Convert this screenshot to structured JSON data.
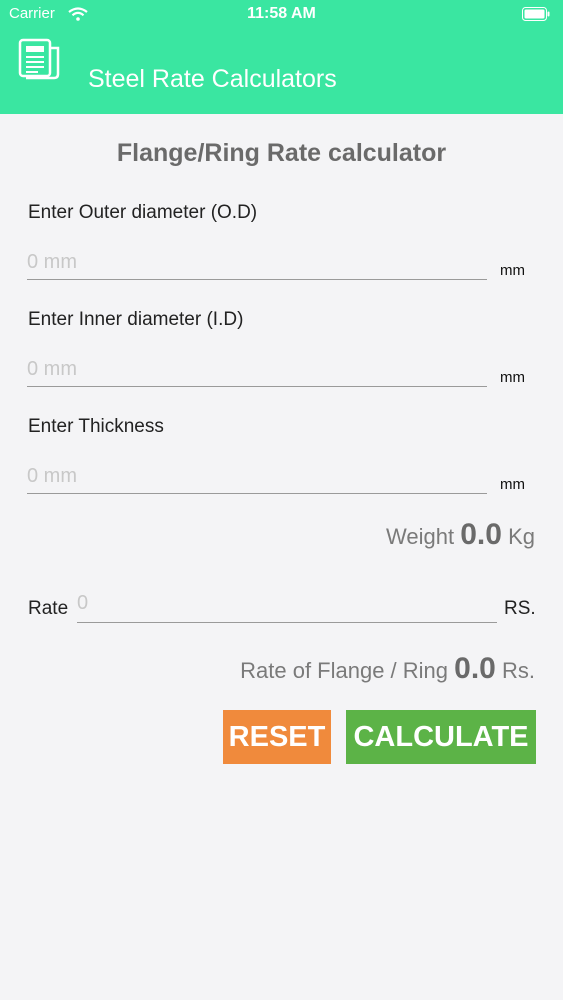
{
  "status_bar": {
    "carrier": "Carrier",
    "time": "11:58 AM"
  },
  "header": {
    "title": "Steel Rate Calculators",
    "icon": "document-icon"
  },
  "page": {
    "title": "Flange/Ring Rate calculator"
  },
  "fields": [
    {
      "label": "Enter Outer diameter (O.D)",
      "placeholder": "0 mm",
      "unit": "mm"
    },
    {
      "label": "Enter Inner diameter (I.D)",
      "placeholder": "0 mm",
      "unit": "mm"
    },
    {
      "label": "Enter Thickness",
      "placeholder": "0 mm",
      "unit": "mm"
    }
  ],
  "weight": {
    "prefix": "Weight",
    "value": "0.0",
    "unit": "Kg"
  },
  "rate": {
    "label": "Rate",
    "placeholder": "0",
    "unit": "RS."
  },
  "rate_result": {
    "prefix": "Rate of Flange / Ring",
    "value": "0.0",
    "unit": "Rs."
  },
  "buttons": {
    "reset": "RESET",
    "calculate": "CALCULATE"
  },
  "colors": {
    "header": "#3ae6a1",
    "reset": "#f08a3c",
    "calculate": "#5cb347"
  }
}
